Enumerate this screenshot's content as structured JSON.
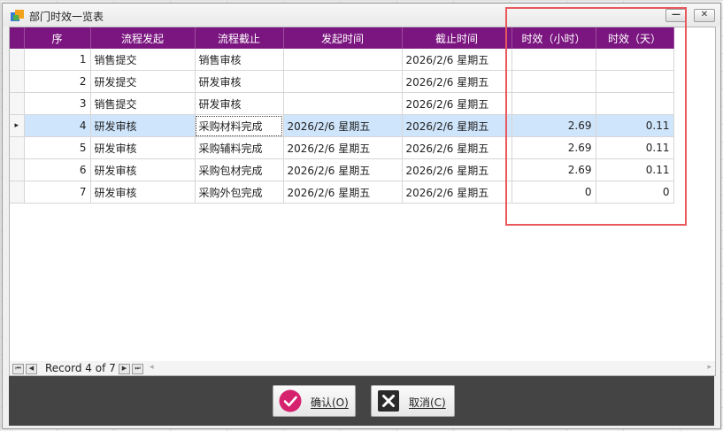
{
  "window": {
    "title": "部门时效一览表",
    "minimize_glyph": "—",
    "close_glyph": "✕"
  },
  "grid": {
    "columns": [
      "序",
      "流程发起",
      "流程截止",
      "发起时间",
      "截止时间",
      "时效（小时）",
      "时效（天）"
    ],
    "rows": [
      [
        "1",
        "销售提交",
        "销售审核",
        "",
        "2026/2/6 星期五",
        "",
        ""
      ],
      [
        "2",
        "研发提交",
        "研发审核",
        "",
        "2026/2/6 星期五",
        "",
        ""
      ],
      [
        "3",
        "销售提交",
        "研发审核",
        "",
        "2026/2/6 星期五",
        "",
        ""
      ],
      [
        "4",
        "研发审核",
        "采购材料完成",
        "2026/2/6 星期五",
        "2026/2/6 星期五",
        "2.69",
        "0.11"
      ],
      [
        "5",
        "研发审核",
        "采购辅料完成",
        "2026/2/6 星期五",
        "2026/2/6 星期五",
        "2.69",
        "0.11"
      ],
      [
        "6",
        "研发审核",
        "采购包材完成",
        "2026/2/6 星期五",
        "2026/2/6 星期五",
        "2.69",
        "0.11"
      ],
      [
        "7",
        "研发审核",
        "采购外包完成",
        "2026/2/6 星期五",
        "2026/2/6 星期五",
        "0",
        "0"
      ]
    ],
    "current_row_indicator": "▸",
    "header_color": "#7b1680",
    "selected_row_color": "#cfe5fb"
  },
  "navigator": {
    "record_text": "Record 4 of 7",
    "first_glyph": "⏮",
    "prev_glyph": "◀",
    "next_glyph": "▶",
    "last_glyph": "⏭"
  },
  "footer": {
    "confirm_label": "确认(O)",
    "cancel_label": "取消(C)",
    "confirm_icon": "check-circle-icon",
    "cancel_icon": "close-x-icon",
    "confirm_color": "#d6216f"
  },
  "annotation_color": "#e9585d"
}
